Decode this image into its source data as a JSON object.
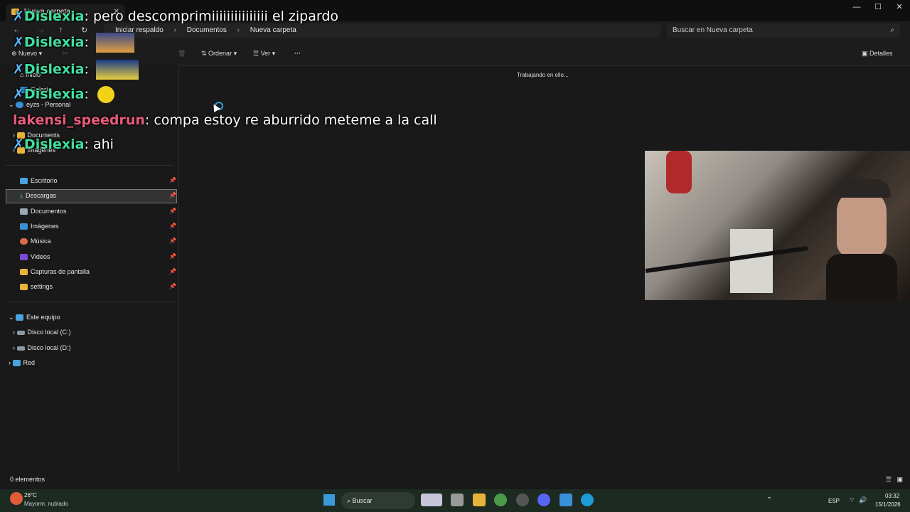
{
  "window": {
    "tab_title": "Nueva carpeta",
    "controls": [
      "—",
      "☐",
      "✕"
    ]
  },
  "address": {
    "crumbs": [
      "Iniciar respaldo",
      "Documentos",
      "Nueva carpeta"
    ],
    "search_placeholder": "Buscar en Nueva carpeta"
  },
  "toolbar": {
    "new": "Nuevo",
    "sort": "Ordenar",
    "view": "Ver",
    "more": "···",
    "details": "Detalles"
  },
  "sidebar": {
    "home": "Inicio",
    "gallery": "Galería",
    "personal": "eyzs - Personal",
    "documents": "Documents",
    "images": "Imágenes",
    "quick": [
      "Escritorio",
      "Descargas",
      "Documentos",
      "Imágenes",
      "Música",
      "Videos",
      "Capturas de pantalla",
      "settings"
    ],
    "this_pc": "Este equipo",
    "drive_c": "Disco local (C:)",
    "drive_d": "Disco local (D:)",
    "network": "Red"
  },
  "content": {
    "loading": "Trabajando en ello..."
  },
  "status": {
    "count": "0 elementos"
  },
  "taskbar": {
    "temp": "26°C",
    "weather": "Mayorm. nublado",
    "search": "Buscar",
    "lang": "ESP",
    "time": "03:32",
    "date": "15/1/2026"
  },
  "chat": [
    {
      "user": "Dislexia",
      "text": ": pero descomprimiiiiiiiiiiiiiii el zipardo"
    },
    {
      "user": "Dislexia",
      "text": ":"
    },
    {
      "user": "Dislexia",
      "text": ":"
    },
    {
      "user": "Dislexia",
      "text": ":"
    },
    {
      "user": "lakensi_speedrun",
      "text": ": compa estoy re aburrido meteme a la call"
    },
    {
      "user": "Dislexia",
      "text": ": ahi"
    }
  ],
  "colors": {
    "accent": "#3ee0a0",
    "nick_alt": "#e85b7a",
    "selection": "#333333"
  }
}
